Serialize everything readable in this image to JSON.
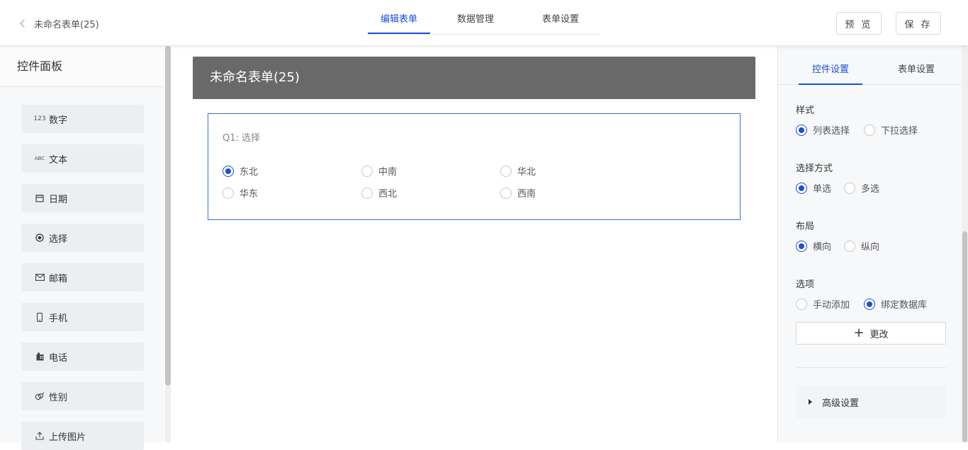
{
  "header": {
    "back_label": "未命名表单(25)",
    "tabs": [
      "编辑表单",
      "数据管理",
      "表单设置"
    ],
    "preview_label": "预 览",
    "save_label": "保 存",
    "accent_color": "#1c4fd8"
  },
  "left_panel": {
    "title": "控件面板",
    "items": [
      {
        "label": "数字",
        "icon": "number-icon",
        "icon_text": "123"
      },
      {
        "label": "文本",
        "icon": "text-icon",
        "icon_text": "ABC"
      },
      {
        "label": "日期",
        "icon": "calendar-icon"
      },
      {
        "label": "选择",
        "icon": "radio-icon"
      },
      {
        "label": "邮箱",
        "icon": "mail-icon"
      },
      {
        "label": "手机",
        "icon": "mobile-icon"
      },
      {
        "label": "电话",
        "icon": "telephone-icon"
      },
      {
        "label": "性别",
        "icon": "gender-icon"
      },
      {
        "label": "上传图片",
        "icon": "upload-icon"
      }
    ]
  },
  "form": {
    "title": "未命名表单(25)",
    "header_color": "#696969",
    "question": {
      "title": "Q1: 选择",
      "options": [
        {
          "label": "东北",
          "checked": true
        },
        {
          "label": "中南",
          "checked": false
        },
        {
          "label": "华北",
          "checked": false
        },
        {
          "label": "华东",
          "checked": false
        },
        {
          "label": "西北",
          "checked": false
        },
        {
          "label": "西南",
          "checked": false
        }
      ]
    }
  },
  "right_panel": {
    "tabs": [
      "控件设置",
      "表单设置"
    ],
    "style": {
      "label": "样式",
      "options": [
        "列表选择",
        "下拉选择"
      ],
      "selected": 0
    },
    "select_mode": {
      "label": "选择方式",
      "options": [
        "单选",
        "多选"
      ],
      "selected": 0
    },
    "layout": {
      "label": "布局",
      "options": [
        "横向",
        "纵向"
      ],
      "selected": 0
    },
    "options_source": {
      "label": "选项",
      "options": [
        "手动添加",
        "绑定数据库"
      ],
      "selected": 1
    },
    "change_button": "更改",
    "advanced_label": "高级设置"
  }
}
